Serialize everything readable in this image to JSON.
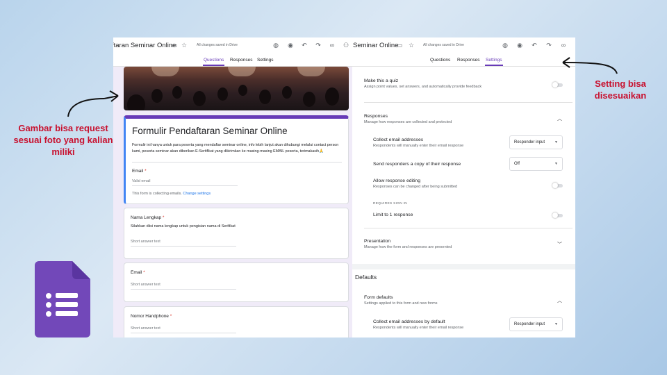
{
  "left_window": {
    "form_title_partial": "ftaran Seminar Online",
    "saved_status": "All changes saved in Drive",
    "tabs": [
      "Questions",
      "Responses",
      "Settings"
    ],
    "active_tab": "Questions",
    "form": {
      "title": "Formulir Pendaftaran Seminar Online",
      "description": "Formulir ini hanya untuk para peserta yang mendaftar seminar online, info lebih lanjut akan dihubungi melalui contact person kami, peserta seminar akan diberikan E-Sertifikat yang dikirimkan ke masing-masing EMAIL peserta, terimakasih🙏",
      "email_label": "Email",
      "email_placeholder": "Valid email",
      "collecting_note": "This form is collecting emails.",
      "change_settings": "Change settings",
      "required_mark": "*",
      "questions": [
        {
          "label": "Nama Lengkap",
          "help": "Silahkan diisi nama lengkap untuk pengisian nama di Serifikat",
          "placeholder": "Short answer text"
        },
        {
          "label": "Email",
          "help": "",
          "placeholder": "Short answer text"
        },
        {
          "label": "Nomor Handphone",
          "help": "",
          "placeholder": "Short answer text"
        }
      ]
    }
  },
  "right_window": {
    "form_title_partial": "Seminar Online",
    "saved_status": "All changes saved in Drive",
    "tabs": [
      "Questions",
      "Responses",
      "Settings"
    ],
    "active_tab": "Settings",
    "quiz": {
      "title": "Make this a quiz",
      "subtitle": "Assign point values, set answers, and automatically provide feedback"
    },
    "responses": {
      "title": "Responses",
      "subtitle": "Manage how responses are collected and protected",
      "collect_email": {
        "title": "Collect email addresses",
        "subtitle": "Respondents will manually enter their email response",
        "value": "Responder input"
      },
      "send_copy": {
        "title": "Send responders a copy of their response",
        "value": "Off"
      },
      "allow_edit": {
        "title": "Allow response editing",
        "subtitle": "Responses can be changed after being submitted"
      },
      "requires_sign_in": "REQUIRES SIGN IN",
      "limit": {
        "title": "Limit to 1 response"
      }
    },
    "presentation": {
      "title": "Presentation",
      "subtitle": "Manage how the form and responses are presented"
    },
    "defaults": {
      "heading": "Defaults",
      "form_defaults": {
        "title": "Form defaults",
        "subtitle": "Settings applied to this form and new forms"
      },
      "collect_default": {
        "title": "Collect email addresses by default",
        "subtitle": "Respondents will manually enter their email response",
        "value": "Responder input"
      }
    }
  },
  "annotations": {
    "left_note": "Gambar bisa request sesuai foto yang kalian miliki",
    "right_note": "Setting bisa disesuaikan"
  },
  "colors": {
    "accent": "#673ab7",
    "annotation": "#c8102e",
    "link": "#1a73e8"
  },
  "icons": [
    "folder-icon",
    "star-icon",
    "palette-icon",
    "preview-icon",
    "undo-icon",
    "redo-icon",
    "link-icon",
    "add-collaborator-icon",
    "expand-icon",
    "collapse-icon",
    "google-forms-logo"
  ]
}
